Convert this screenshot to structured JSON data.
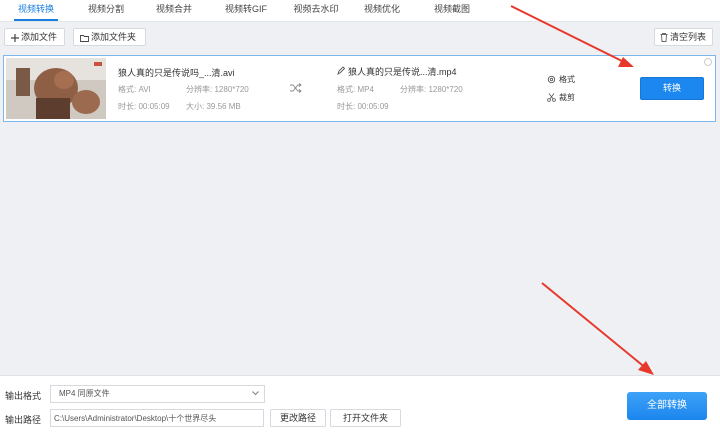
{
  "tabs": [
    {
      "label": "视频转换",
      "active": true
    },
    {
      "label": "视频分割"
    },
    {
      "label": "视频合并"
    },
    {
      "label": "视频转GIF"
    },
    {
      "label": "视频去水印"
    },
    {
      "label": "视频优化"
    },
    {
      "label": "视频截图"
    }
  ],
  "toolbar": {
    "add_file": "添加文件",
    "add_folder": "添加文件夹",
    "clear_list": "清空列表"
  },
  "file": {
    "source_name": "狼人真的只是传说吗_...清.avi",
    "source_format_label": "格式:",
    "source_format": "AVI",
    "source_resolution_label": "分辨率:",
    "source_resolution": "1280*720",
    "source_duration_label": "时长:",
    "source_duration": "00:05:09",
    "source_size_label": "大小:",
    "source_size": "39.56 MB",
    "target_name": "狼人真的只是传说...清.mp4",
    "target_format_label": "格式:",
    "target_format": "MP4",
    "target_resolution_label": "分辨率:",
    "target_resolution": "1280*720",
    "target_duration_label": "时长:",
    "target_duration": "00:05:09",
    "format_action": "格式",
    "cut_action": "裁剪",
    "convert_button": "转换"
  },
  "bottom": {
    "output_format_label": "输出格式",
    "output_format_value": "MP4  同原文件",
    "output_path_label": "输出路径",
    "output_path_value": "C:\\Users\\Administrator\\Desktop\\十个世界尽头",
    "change_path": "更改路径",
    "open_folder": "打开文件夹",
    "convert_all": "全部转换"
  },
  "colors": {
    "accent": "#1c87ee",
    "arrow": "#e8382b"
  }
}
